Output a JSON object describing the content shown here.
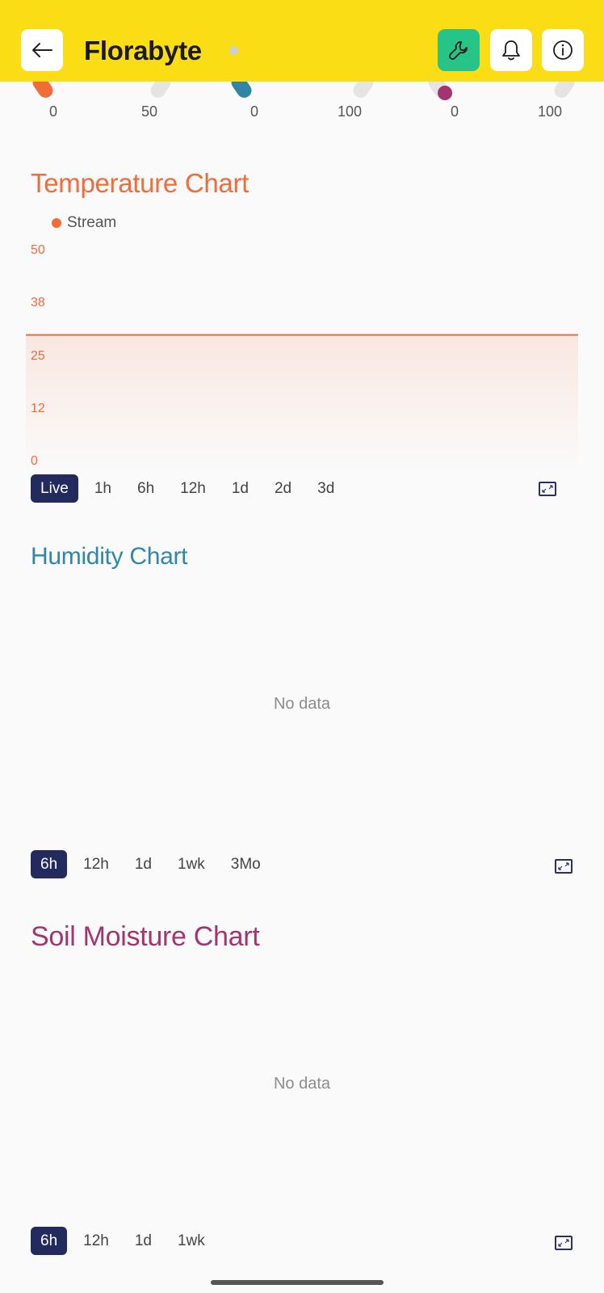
{
  "header": {
    "title": "Florabyte",
    "back_icon": "arrow-left-icon",
    "tool_icon": "wrench-icon",
    "bell_icon": "bell-icon",
    "info_icon": "info-icon",
    "accent": "#fbdd16",
    "tool_color": "#27c48a"
  },
  "gauges": [
    {
      "name": "temperature",
      "min": "0",
      "max": "50",
      "color": "#f26b38"
    },
    {
      "name": "humidity",
      "min": "0",
      "max": "100",
      "color": "#2f86a6"
    },
    {
      "name": "soil-moisture",
      "min": "0",
      "max": "100",
      "color": "#a2356f"
    }
  ],
  "temperature": {
    "title": "Temperature Chart",
    "color": "#f26b38",
    "ranges": [
      "Live",
      "1h",
      "6h",
      "12h",
      "1d",
      "2d",
      "3d"
    ],
    "active_range": "Live"
  },
  "humidity": {
    "title": "Humidity Chart",
    "color": "#2f86a6",
    "empty_text": "No data",
    "ranges": [
      "6h",
      "12h",
      "1d",
      "1wk",
      "3Mo"
    ],
    "active_range": "6h"
  },
  "soil": {
    "title": "Soil Moisture Chart",
    "color": "#a2356f",
    "empty_text": "No data",
    "ranges": [
      "6h",
      "12h",
      "1d",
      "1wk"
    ],
    "active_range": "6h"
  },
  "chart_data": {
    "type": "area",
    "title": "Temperature Chart",
    "series": [
      {
        "name": "Stream",
        "values": [
          29.5,
          29.5
        ]
      }
    ],
    "yticks": [
      "50",
      "38",
      "25",
      "12",
      "0"
    ],
    "ylim": [
      0,
      50
    ],
    "grid": false,
    "legend": "top-left"
  }
}
